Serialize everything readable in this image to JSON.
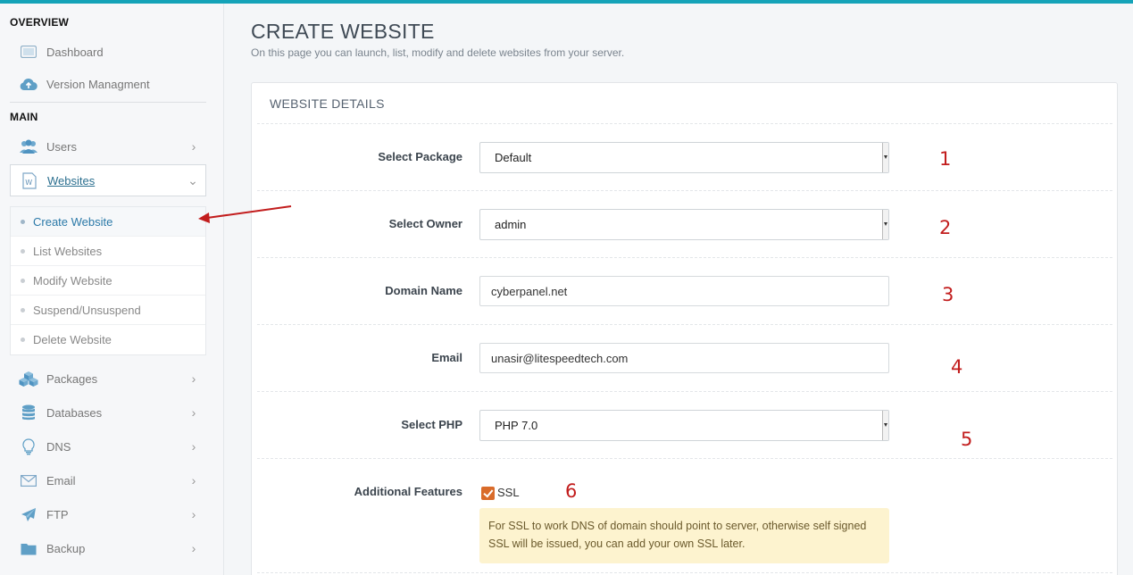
{
  "sidebar": {
    "sections": {
      "overview": "OVERVIEW",
      "main": "MAIN"
    },
    "overview_items": [
      {
        "label": "Dashboard",
        "icon": "dashboard-icon"
      },
      {
        "label": "Version Managment",
        "icon": "cloud-upload-icon"
      }
    ],
    "main_items": {
      "users": "Users",
      "websites": "Websites",
      "packages": "Packages",
      "databases": "Databases",
      "dns": "DNS",
      "email": "Email",
      "ftp": "FTP",
      "backup": "Backup"
    },
    "websites_submenu": [
      "Create Website",
      "List Websites",
      "Modify Website",
      "Suspend/Unsuspend",
      "Delete Website"
    ]
  },
  "page": {
    "title": "CREATE WEBSITE",
    "subtitle": "On this page you can launch, list, modify and delete websites from your server."
  },
  "panel": {
    "title": "WEBSITE DETAILS",
    "fields": {
      "package": {
        "label": "Select Package",
        "value": "Default",
        "marker": "1"
      },
      "owner": {
        "label": "Select Owner",
        "value": "admin",
        "marker": "2"
      },
      "domain": {
        "label": "Domain Name",
        "value": "cyberpanel.net",
        "marker": "3"
      },
      "email": {
        "label": "Email",
        "value": "unasir@litespeedtech.com",
        "marker": "4"
      },
      "php": {
        "label": "Select PHP",
        "value": "PHP 7.0",
        "marker": "5"
      },
      "features": {
        "label": "Additional Features",
        "ssl_label": "SSL",
        "ssl_checked": true,
        "marker": "6"
      }
    },
    "ssl_note": "For SSL to work DNS of domain should point to server, otherwise self signed SSL will be issued, you can add your own SSL later."
  },
  "colors": {
    "accent": "#14a3b8",
    "checkbox": "#d96b2a",
    "annotation": "#c21d1d",
    "note_bg": "#fdf3cf"
  }
}
